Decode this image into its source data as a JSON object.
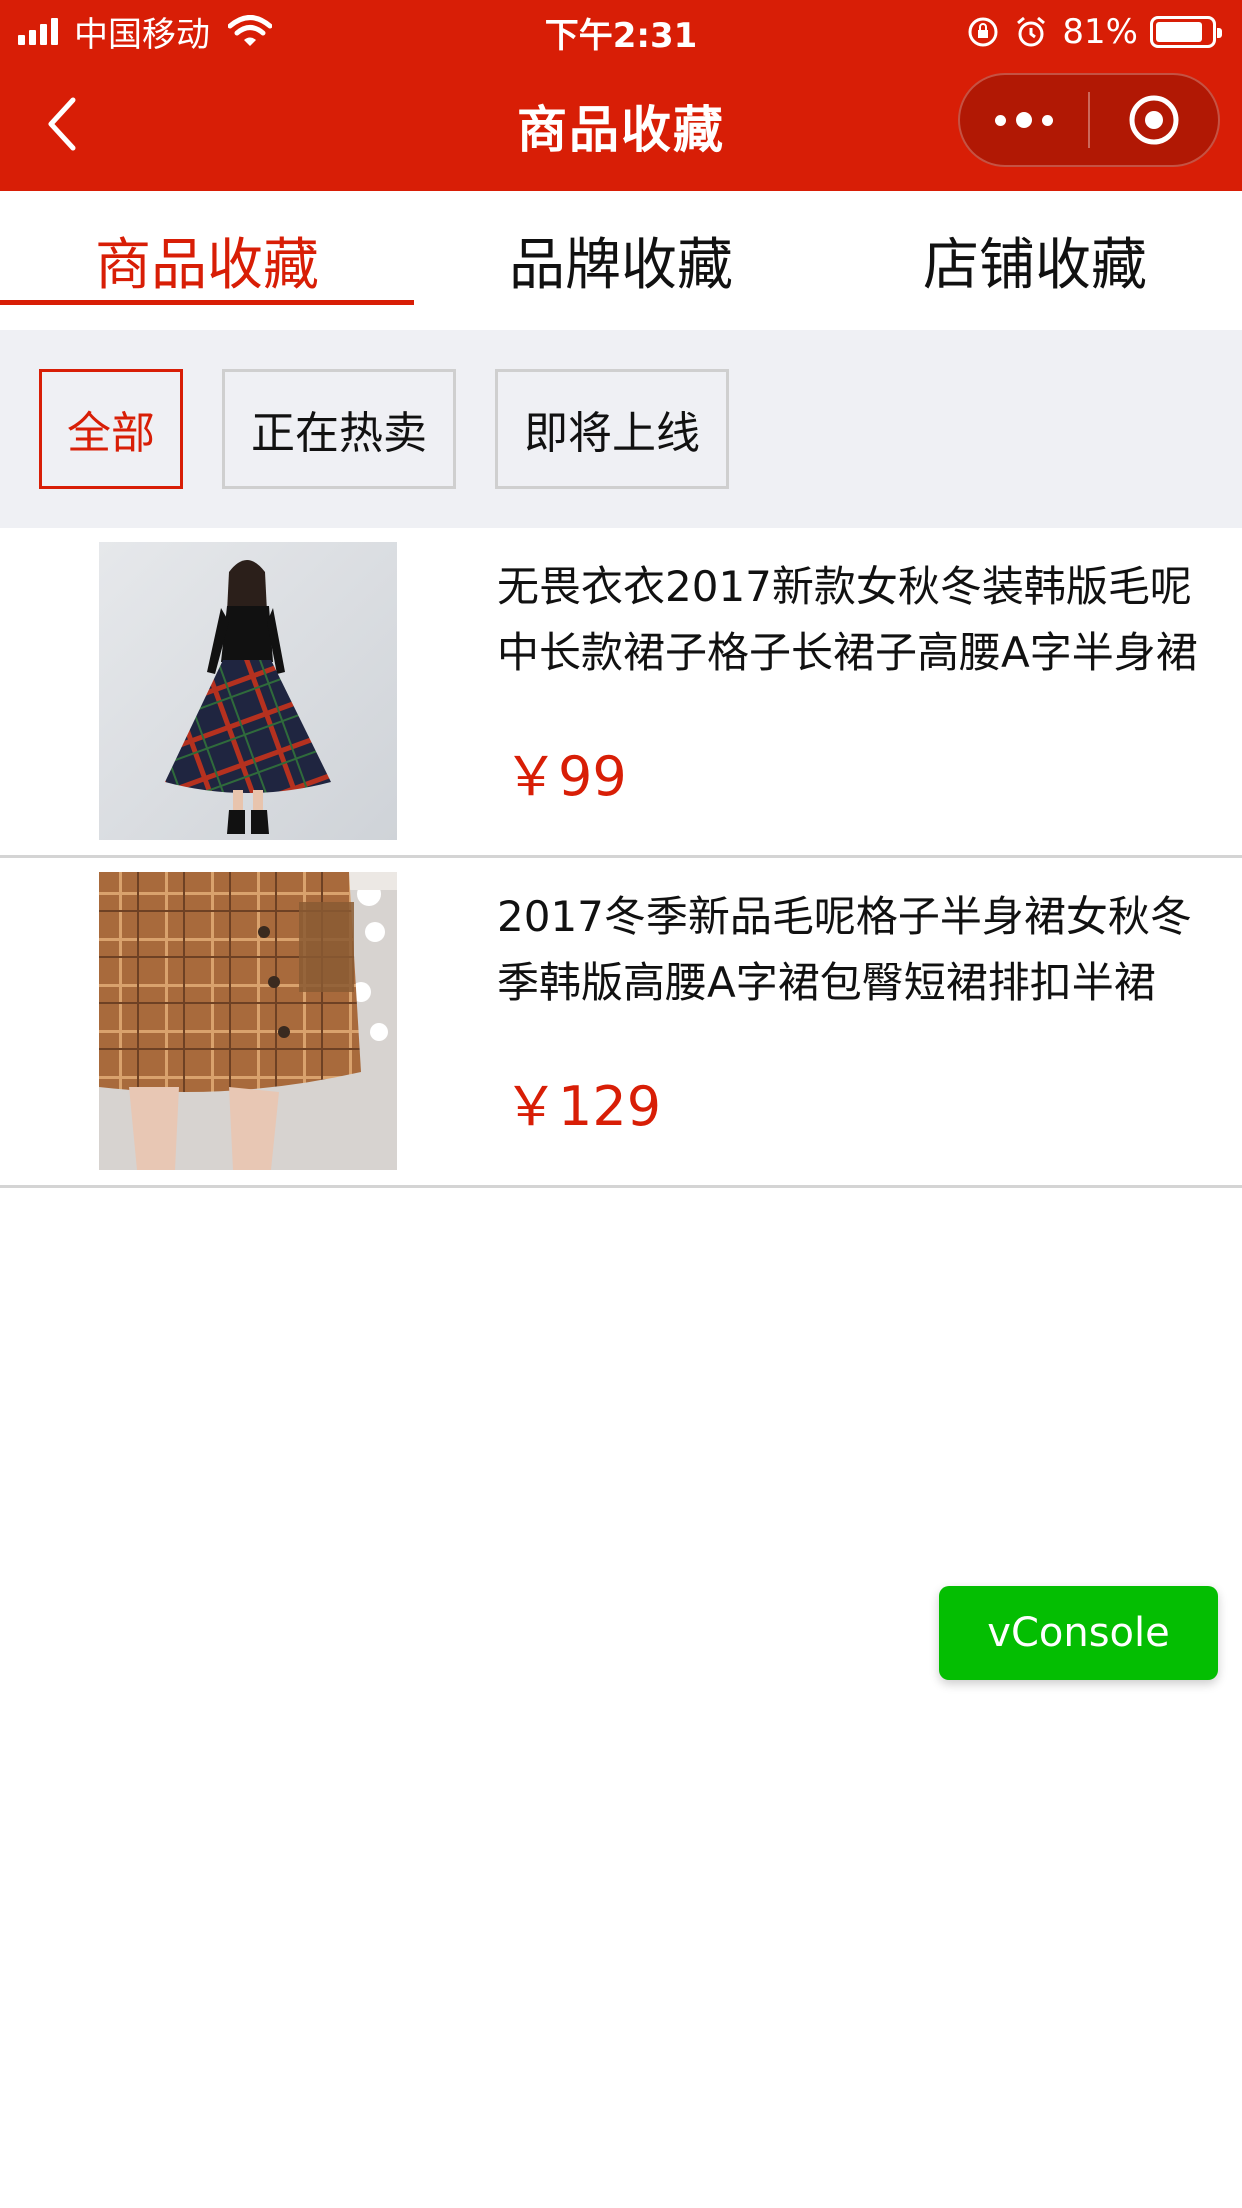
{
  "status_bar": {
    "carrier": "中国移动",
    "time": "下午2:31",
    "battery": "81%",
    "battery_level": 0.81
  },
  "nav": {
    "title": "商品收藏",
    "icons": [
      "back-arrow-icon",
      "more-dots-icon",
      "close-target-icon"
    ]
  },
  "tabs": [
    {
      "label": "商品收藏",
      "active": true
    },
    {
      "label": "品牌收藏",
      "active": false
    },
    {
      "label": "店铺收藏",
      "active": false
    }
  ],
  "filters": [
    {
      "label": "全部",
      "active": true
    },
    {
      "label": "正在热卖",
      "active": false
    },
    {
      "label": "即将上线",
      "active": false
    }
  ],
  "products": [
    {
      "title": "无畏衣衣2017新款女秋冬装韩版毛呢中长款裙子格子长裙子高腰A字半身裙",
      "price": "￥99"
    },
    {
      "title": "2017冬季新品毛呢格子半身裙女秋冬季韩版高腰A字裙包臀短裙排扣半裙",
      "price": "￥129"
    }
  ],
  "vconsole_label": "vConsole",
  "colors": {
    "brand_red": "#d81e06",
    "filter_bg": "#eff0f4",
    "vconsole_green": "#04be02"
  }
}
